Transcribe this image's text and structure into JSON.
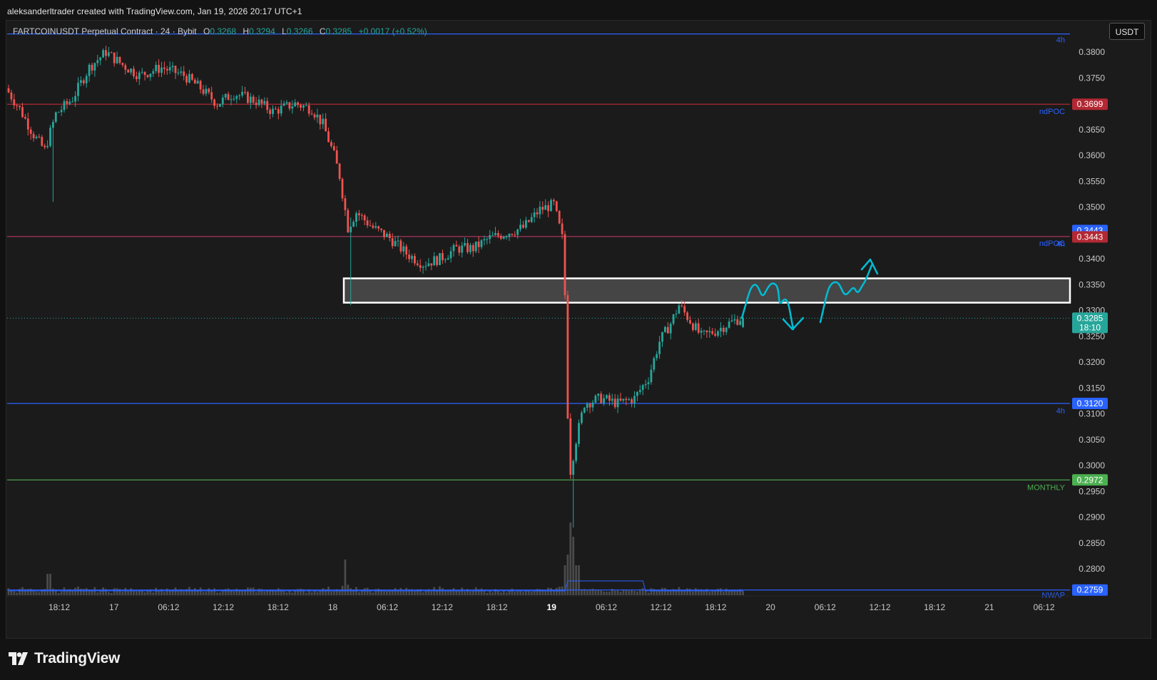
{
  "header": {
    "credit": "aleksanderltrader created with TradingView.com, Jan 19, 2026 20:17 UTC+1"
  },
  "legend": {
    "symbol": "FARTCOINUSDT Perpetual Contract · 24 · Bybit",
    "open_label": "O",
    "open": "0.3268",
    "high_label": "H",
    "high": "0.3294",
    "low_label": "L",
    "low": "0.3266",
    "close_label": "C",
    "close": "0.3285",
    "change": "+0.0017 (+0.52%)"
  },
  "currency_button": "USDT",
  "brand": {
    "name": "TradingView",
    "icon": "tradingview-logo-icon"
  },
  "colors": {
    "background": "#1b1b1b",
    "up": "#26a69a",
    "down": "#ef5350",
    "blue_level": "#2962ff",
    "red_level": "#b22833",
    "green_level": "#4caf50",
    "drawing": "#00bcd4",
    "zone_fill": "#4a4a4a"
  },
  "chart_data": {
    "type": "candlestick",
    "title": "FARTCOINUSDT Perpetual Contract · 24 · Bybit",
    "ylim": [
      0.2745,
      0.3843
    ],
    "y_ticks": [
      "0.3800",
      "0.3750",
      "0.3700",
      "0.3650",
      "0.3600",
      "0.3550",
      "0.3500",
      "0.3450",
      "0.3400",
      "0.3350",
      "0.3300",
      "0.3250",
      "0.3200",
      "0.3150",
      "0.3100",
      "0.3050",
      "0.3000",
      "0.2950",
      "0.2900",
      "0.2850",
      "0.2800"
    ],
    "x_ticks": [
      {
        "label": "18:12",
        "bold": false
      },
      {
        "label": "17",
        "bold": false
      },
      {
        "label": "06:12",
        "bold": false
      },
      {
        "label": "12:12",
        "bold": false
      },
      {
        "label": "18:12",
        "bold": false
      },
      {
        "label": "18",
        "bold": false
      },
      {
        "label": "06:12",
        "bold": false
      },
      {
        "label": "12:12",
        "bold": false
      },
      {
        "label": "18:12",
        "bold": false
      },
      {
        "label": "19",
        "bold": true
      },
      {
        "label": "06:12",
        "bold": false
      },
      {
        "label": "12:12",
        "bold": false
      },
      {
        "label": "18:12",
        "bold": false
      },
      {
        "label": "20",
        "bold": false
      },
      {
        "label": "06:12",
        "bold": false
      },
      {
        "label": "12:12",
        "bold": false
      },
      {
        "label": "18:12",
        "bold": false
      },
      {
        "label": "21",
        "bold": false
      },
      {
        "label": "06:12",
        "bold": false
      }
    ],
    "price_path": [
      [
        0,
        0.373
      ],
      [
        5,
        0.369
      ],
      [
        10,
        0.364
      ],
      [
        14,
        0.361
      ],
      [
        18,
        0.368
      ],
      [
        24,
        0.371
      ],
      [
        30,
        0.377
      ],
      [
        36,
        0.38
      ],
      [
        42,
        0.3775
      ],
      [
        48,
        0.3755
      ],
      [
        56,
        0.377
      ],
      [
        64,
        0.3755
      ],
      [
        70,
        0.373
      ],
      [
        76,
        0.37
      ],
      [
        82,
        0.372
      ],
      [
        90,
        0.3705
      ],
      [
        96,
        0.3685
      ],
      [
        104,
        0.37
      ],
      [
        110,
        0.369
      ],
      [
        114,
        0.366
      ],
      [
        118,
        0.36
      ],
      [
        120,
        0.356
      ],
      [
        123,
        0.346
      ],
      [
        126,
        0.349
      ],
      [
        132,
        0.346
      ],
      [
        138,
        0.344
      ],
      [
        144,
        0.341
      ],
      [
        150,
        0.339
      ],
      [
        156,
        0.34
      ],
      [
        162,
        0.342
      ],
      [
        168,
        0.342
      ],
      [
        174,
        0.344
      ],
      [
        180,
        0.345
      ],
      [
        186,
        0.346
      ],
      [
        192,
        0.3495
      ],
      [
        197,
        0.3505
      ],
      [
        200,
        0.344
      ],
      [
        201,
        0.333
      ],
      [
        202,
        0.31
      ],
      [
        203,
        0.299
      ],
      [
        205,
        0.305
      ],
      [
        208,
        0.312
      ],
      [
        214,
        0.313
      ],
      [
        220,
        0.312
      ],
      [
        226,
        0.313
      ],
      [
        231,
        0.317
      ],
      [
        235,
        0.324
      ],
      [
        239,
        0.3275
      ],
      [
        242,
        0.331
      ],
      [
        246,
        0.328
      ],
      [
        250,
        0.325
      ],
      [
        255,
        0.326
      ],
      [
        260,
        0.3275
      ],
      [
        264,
        0.3285
      ]
    ],
    "spikes": [
      {
        "candle": 16,
        "low": 0.351
      },
      {
        "candle": 123,
        "high": 0.348,
        "low": 0.331
      },
      {
        "candle": 203,
        "low": 0.288
      },
      {
        "candle": 242,
        "high": 0.332
      }
    ],
    "levels": [
      {
        "price": 0.3835,
        "color": "#2962ff",
        "label": "4h",
        "badge": ""
      },
      {
        "price": 0.3699,
        "color": "#b22833",
        "label": "ndPOC",
        "badge": "0.3699"
      },
      {
        "price": 0.3443,
        "color": "#2962ff",
        "label": "4h",
        "badge": "0.3443",
        "badge_offset": -1
      },
      {
        "price": 0.3443,
        "color": "#b22833",
        "label": "ndPOC",
        "badge": "0.3443",
        "badge_offset": 1
      },
      {
        "price": 0.3285,
        "color": "#26a69a",
        "label": "",
        "badge": "0.3285",
        "badge2": "18:10",
        "dotted": true
      },
      {
        "price": 0.312,
        "color": "#2962ff",
        "label": "4h",
        "badge": "0.3120"
      },
      {
        "price": 0.2972,
        "color": "#4caf50",
        "label": "MONTHLY",
        "badge": "0.2972"
      },
      {
        "price": 0.2759,
        "color": "#2962ff",
        "label": "NWAP",
        "badge": "0.2759"
      }
    ],
    "zone": {
      "price_top": 0.3362,
      "price_bottom": 0.3315
    },
    "projections": [
      {
        "name": "bearish-scenario",
        "points": [
          [
            0.3295
          ],
          [
            0.3345
          ],
          [
            0.334
          ],
          [
            0.3352
          ],
          [
            0.332
          ],
          [
            0.3275
          ]
        ]
      },
      {
        "name": "bullish-scenario",
        "points": [
          [
            0.329
          ],
          [
            0.3345
          ],
          [
            0.3335
          ],
          [
            0.335
          ],
          [
            0.334
          ],
          [
            0.3395
          ]
        ]
      }
    ],
    "grid": false,
    "volume": true
  }
}
